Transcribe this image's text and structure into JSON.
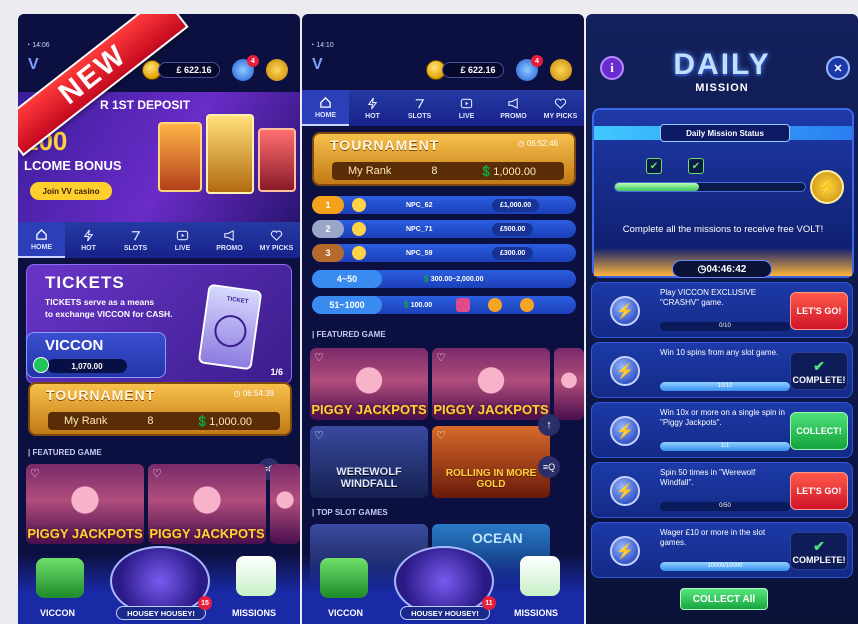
{
  "left": {
    "time": "14:06",
    "balance": "£ 622.16",
    "notif_count": "4",
    "ribbon": "NEW",
    "promo": {
      "line1": "R 1ST DEPOSIT",
      "amount": "100",
      "bonus": "LCOME BONUS",
      "cta": "Join VV casino"
    },
    "nav": [
      "HOME",
      "HOT",
      "SLOTS",
      "LIVE",
      "PROMO",
      "MY PICKS"
    ],
    "tickets": {
      "title": "TICKETS",
      "desc1": "TICKETS serve as a means",
      "desc2": "to exchange VICCON for CASH.",
      "page": "1/6",
      "ticket_label": "TICKET"
    },
    "viccon": {
      "title": "VICCON",
      "value": "1,070.00"
    },
    "tournament": {
      "title": "TOURNAMENT",
      "timer": "06:54:39",
      "rank_label": "My Rank",
      "rank": "8",
      "prize": "1,000.00"
    },
    "featured_label": "FEATURED GAME",
    "games": [
      "PIGGY JACKPOTS",
      "PIGGY JACKPOTS"
    ],
    "bottom": {
      "viccon": "VICCON",
      "housey": "HOUSEY HOUSEY!",
      "housey_badge": "15",
      "missions": "MISSIONS"
    }
  },
  "middle": {
    "time": "14:10",
    "balance": "£ 622.16",
    "notif_count": "4",
    "nav": [
      "HOME",
      "HOT",
      "SLOTS",
      "LIVE",
      "PROMO",
      "MY PICKS"
    ],
    "tournament": {
      "title": "TOURNAMENT",
      "timer": "06:52:46",
      "rank_label": "My Rank",
      "rank": "8",
      "prize": "1,000.00"
    },
    "ranks": [
      {
        "pos": "1",
        "name": "NPC_62",
        "prize": "£1,000.00"
      },
      {
        "pos": "2",
        "name": "NPC_71",
        "prize": "£500.00"
      },
      {
        "pos": "3",
        "name": "NPC_59",
        "prize": "£300.00"
      }
    ],
    "tier1": {
      "range": "4~50",
      "prize": "300.00~2,000.00"
    },
    "tier2": {
      "range": "51~1000",
      "prize": "100.00"
    },
    "featured_label": "FEATURED GAME",
    "games": [
      "PIGGY JACKPOTS",
      "PIGGY JACKPOTS",
      "WEREWOLF WINDFALL",
      "ROLLING IN MORE GOLD"
    ],
    "top_slots_label": "TOP SLOT GAMES",
    "game_extra": "OCEAN",
    "bottom": {
      "viccon": "VICCON",
      "housey": "HOUSEY HOUSEY!",
      "housey_badge": "11",
      "missions": "MISSIONS"
    }
  },
  "right": {
    "title_top": "DAILY",
    "title_bottom": "MISSION",
    "status_label": "Daily Mission Status",
    "complete_text": "Complete all the missions to receive free VOLT!",
    "timer": "04:46:42",
    "missions": [
      {
        "text": "Play VICCON EXCLUSIVE \"CRASHV\" game.",
        "progress": "0/10",
        "fraction": 0,
        "button": "LET'S GO!",
        "state": "go"
      },
      {
        "text": "Win 10 spins from any slot game.",
        "progress": "10/10",
        "fraction": 1,
        "button": "COMPLETE!",
        "state": "done"
      },
      {
        "text": "Win 10x or more on a single spin in \"Piggy Jackpots\".",
        "progress": "1/1",
        "fraction": 1,
        "button": "COLLECT!",
        "state": "collect"
      },
      {
        "text": "Spin 50 times in \"Werewolf Windfall\".",
        "progress": "0/50",
        "fraction": 0,
        "button": "LET'S GO!",
        "state": "go"
      },
      {
        "text": "Wager £10 or more in the slot games.",
        "progress": "10000/10000",
        "fraction": 1,
        "button": "COMPLETE!",
        "state": "done"
      }
    ],
    "collect_all": "COLLECT All",
    "colors": {
      "go": "#e11c30",
      "collect": "#1fb44a",
      "accent": "#f3c33a"
    }
  }
}
